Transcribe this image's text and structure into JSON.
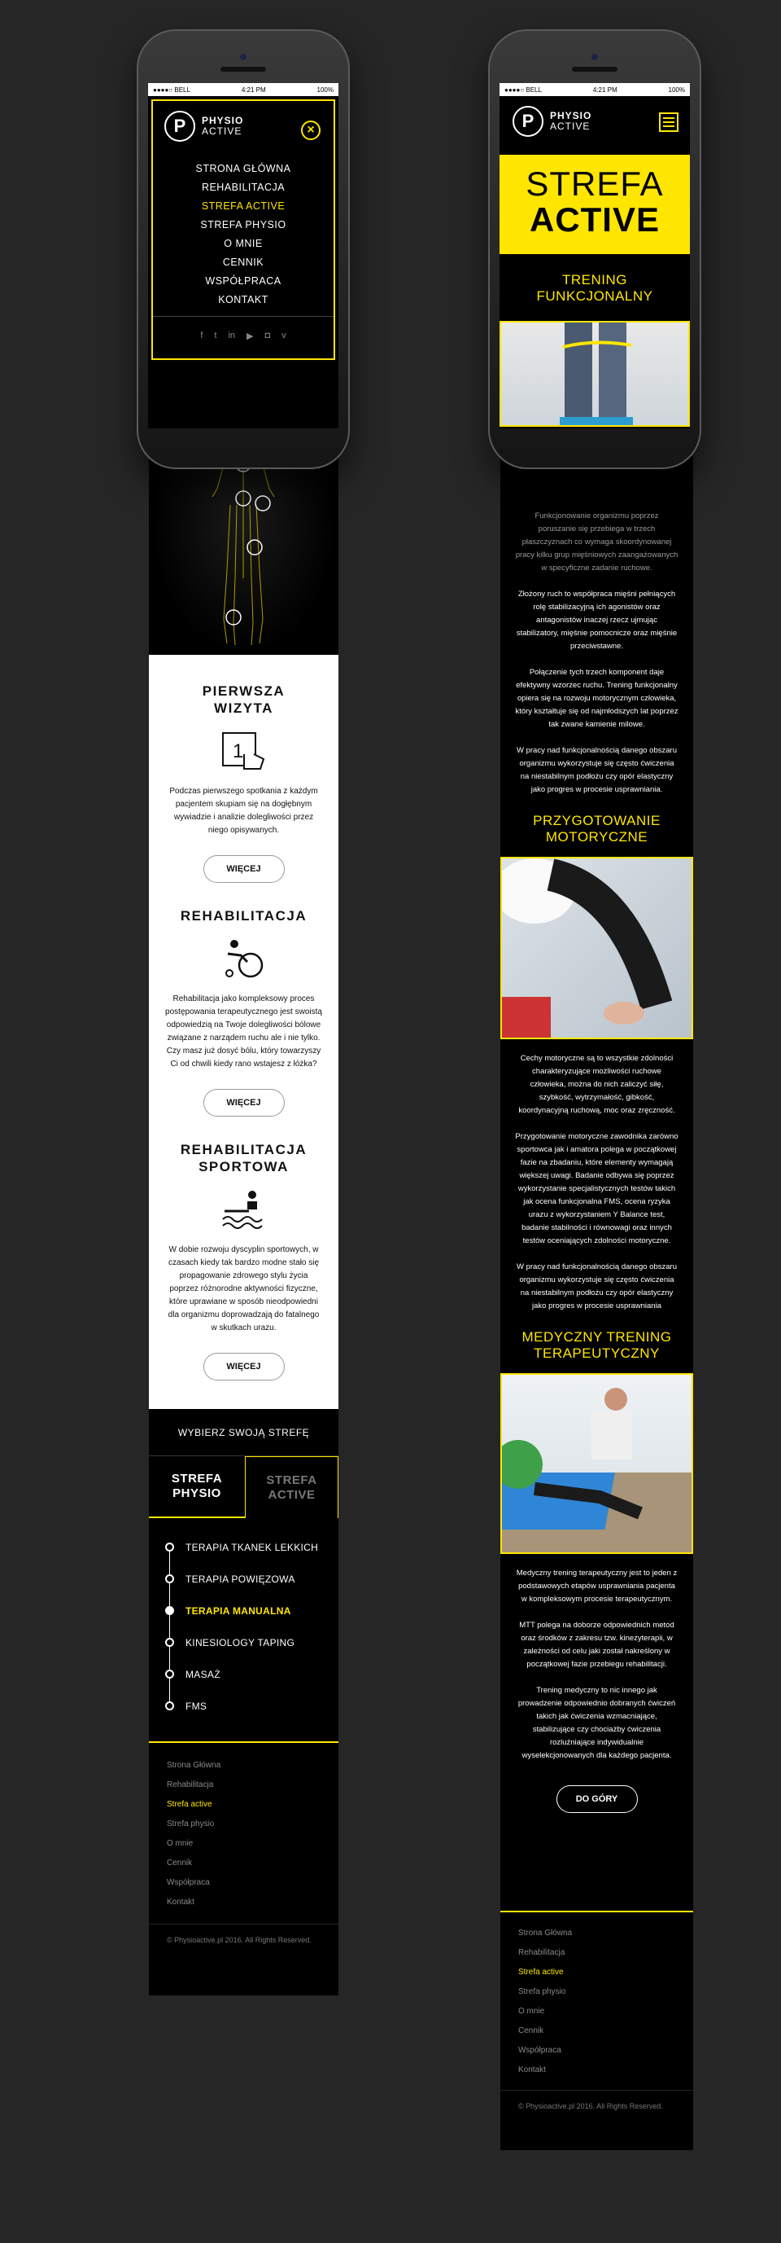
{
  "colors": {
    "accent": "#ffe600",
    "bg": "#262626",
    "panel": "#000000"
  },
  "phone": {
    "status_carrier": "●●●●○ BELL",
    "status_time": "4:21 PM",
    "status_battery": "100%"
  },
  "logo": {
    "mark": "P",
    "line1": "PHYSIO",
    "line2": "ACTIVE"
  },
  "nav": {
    "items": [
      {
        "label": "STRONA GŁÓWNA",
        "active": false
      },
      {
        "label": "REHABILITACJA",
        "active": false
      },
      {
        "label": "STREFA ACTIVE",
        "active": true
      },
      {
        "label": "STREFA PHYSIO",
        "active": false
      },
      {
        "label": "O MNIE",
        "active": false
      },
      {
        "label": "CENNIK",
        "active": false
      },
      {
        "label": "WSPÓŁPRACA",
        "active": false
      },
      {
        "label": "KONTAKT",
        "active": false
      }
    ],
    "social": [
      "facebook-icon",
      "twitter-icon",
      "linkedin-icon",
      "youtube-icon",
      "instagram-icon",
      "vine-icon"
    ]
  },
  "left": {
    "services": [
      {
        "title": "PIERWSZA\nWIZYTA",
        "icon": "touch-icon",
        "text": "Podczas pierwszego spotkania z każdym pacjentem skupiam się na dogłębnym wywiadzie i analizie dolegliwości przez niego opisywanych.",
        "button": "WIĘCEJ"
      },
      {
        "title": "REHABILITACJA",
        "icon": "wheelchair-icon",
        "text": "Rehabilitacja jako kompleksowy proces postępowania terapeutycznego jest swoistą odpowiedzią na Twoje dolegliwości bólowe związane z narządem ruchu ale i nie tylko. Czy masz już dosyć bólu, który towarzyszy Ci od chwili kiedy rano wstajesz z łóżka?",
        "button": "WIĘCEJ"
      },
      {
        "title": "REHABILITACJA\nSPORTOWA",
        "icon": "swimmer-icon",
        "text": "W dobie rozwoju dyscyplin sportowych, w czasach kiedy tak bardzo modne stało się propagowanie zdrowego stylu życia poprzez różnorodne aktywności fizyczne, które uprawiane w sposób nieodpowiedni dla organizmu doprowadzają do fatalnego w skutkach urazu.",
        "button": "WIĘCEJ"
      }
    ],
    "zone_heading": "WYBIERZ SWOJĄ STREFĘ",
    "zone_tabs": [
      {
        "label": "STREFA\nPHYSIO",
        "active": true
      },
      {
        "label": "STREFA\nACTIVE",
        "active": false
      }
    ],
    "timeline": [
      {
        "label": "TERAPIA TKANEK LEKKICH",
        "active": false
      },
      {
        "label": "TERAPIA POWIĘZOWA",
        "active": false
      },
      {
        "label": "TERAPIA MANUALNA",
        "active": true
      },
      {
        "label": "KINESIOLOGY TAPING",
        "active": false
      },
      {
        "label": "MASAŻ",
        "active": false
      },
      {
        "label": "FMS",
        "active": false
      }
    ]
  },
  "footer": {
    "links": [
      {
        "label": "Strona Główna",
        "active": false
      },
      {
        "label": "Rehabilitacja",
        "active": false
      },
      {
        "label": "Strefa active",
        "active": true
      },
      {
        "label": "Strefa physio",
        "active": false
      },
      {
        "label": "O mnie",
        "active": false
      },
      {
        "label": "Cennik",
        "active": false
      },
      {
        "label": "Współpraca",
        "active": false
      },
      {
        "label": "Kontakt",
        "active": false
      }
    ],
    "copyright": "© Physioactive.pl 2016. All Rights Reserved."
  },
  "right": {
    "hero_line1": "STREFA",
    "hero_line2": "ACTIVE",
    "sections": [
      {
        "title": "TRENING\nFUNKCJONALNY",
        "paragraphs": [
          "Funkcjonowanie organizmu poprzez poruszanie się przebiega w trzech płaszczyznach co wymaga skoordynowanej pracy kilku grup mięśniowych zaangażowanych w specyficzne zadanie ruchowe.",
          "Złożony ruch to współpraca mięśni pełniących rolę stabilizacyjną ich agonistów oraz antagonistów inaczej rzecz ujmując stabilizatory, mięśnie pomocnicze oraz mięśnie przeciwstawne.",
          "Połączenie tych trzech komponent daje efektywny wzorzec ruchu. Trening funkcjonalny opiera się na rozwoju motorycznym człowieka, który kształtuje się od najmłodszych lat poprzez tak zwane kamienie milowe.",
          "W pracy nad funkcjonalnością danego obszaru organizmu wykorzystuje się często ćwiczenia na niestabilnym podłożu czy opór elastyczny jako progres w procesie usprawniania."
        ]
      },
      {
        "title": "PRZYGOTOWANIE\nMOTORYCZNE",
        "paragraphs": [
          "Cechy motoryczne są to wszystkie zdolności charakteryzujące możliwości ruchowe człowieka, można do nich zaliczyć siłę, szybkość, wytrzymałość, gibkość, koordynacyjną ruchową, moc oraz zręczność.",
          "Przygotowanie motoryczne zawodnika zarówno sportowca jak i amatora polega w początkowej fazie na zbadaniu, które elementy wymagają większej uwagi. Badanie odbywa się poprzez wykorzystanie specjalistycznych testów takich jak ocena funkcjonalna FMS, ocena ryzyka urazu z wykorzystaniem Y Balance test, badanie stabilności i równowagi oraz innych testów oceniających zdolności motoryczne.",
          "W pracy nad funkcjonalnością danego obszaru organizmu wykorzystuje się często ćwiczenia na niestabilnym podłożu czy opór elastyczny jako progres w procesie usprawniania"
        ]
      },
      {
        "title": "MEDYCZNY TRENING\nTERAPEUTYCZNY",
        "paragraphs": [
          "Medyczny trening terapeutyczny jest to jeden z podstawowych etapów usprawniania pacjenta w kompleksowym procesie terapeutycznym.",
          "MTT polega na doborze odpowiednich metod oraz środków z zakresu tzw. kinezyterapii, w zależności od celu jaki został nakreślony w początkowej fazie przebiegu rehabilitacji.",
          "Trening medyczny to nic innego jak prowadzenie odpowiednio dobranych ćwiczeń takich jak ćwiczenia wzmacniające, stabilizujące czy chociażby ćwiczenia rozluźniające indywidualnie wyselekcjonowanych dla każdego pacjenta."
        ]
      }
    ],
    "top_button": "DO GÓRY"
  }
}
